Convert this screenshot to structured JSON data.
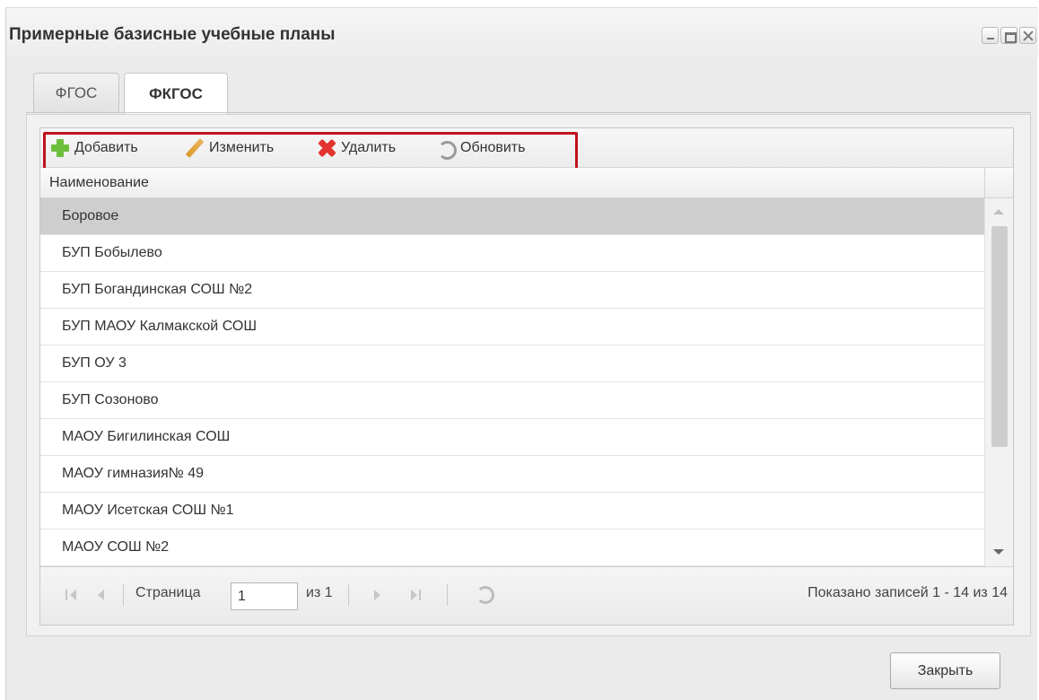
{
  "window": {
    "title": "Примерные базисные учебные планы"
  },
  "tabs": [
    {
      "label": "ФГОС",
      "active": false
    },
    {
      "label": "ФКГОС",
      "active": true
    }
  ],
  "toolbar": {
    "add_label": "Добавить",
    "edit_label": "Изменить",
    "delete_label": "Удалить",
    "refresh_label": "Обновить",
    "highlight_color": "#c0121d"
  },
  "grid": {
    "column_header": "Наименование",
    "rows": [
      "Боровое",
      "БУП Бобылево",
      "БУП Богандинская СОШ №2",
      "БУП МАОУ Калмакской СОШ",
      "БУП ОУ 3",
      "БУП Созоново",
      "МАОУ Бигилинская СОШ",
      "МАОУ гимназия№ 49",
      "МАОУ Исетская СОШ №1",
      "МАОУ СОШ №2"
    ],
    "selected_row": 0
  },
  "pager": {
    "page_label": "Страница",
    "page_value": "1",
    "of_label": "из 1",
    "info": "Показано записей 1 - 14 из 14"
  },
  "footer": {
    "close_label": "Закрыть"
  },
  "icons": {
    "add": "plus-icon",
    "edit": "pencil-icon",
    "delete": "red-x-icon",
    "refresh": "refresh-icon"
  }
}
